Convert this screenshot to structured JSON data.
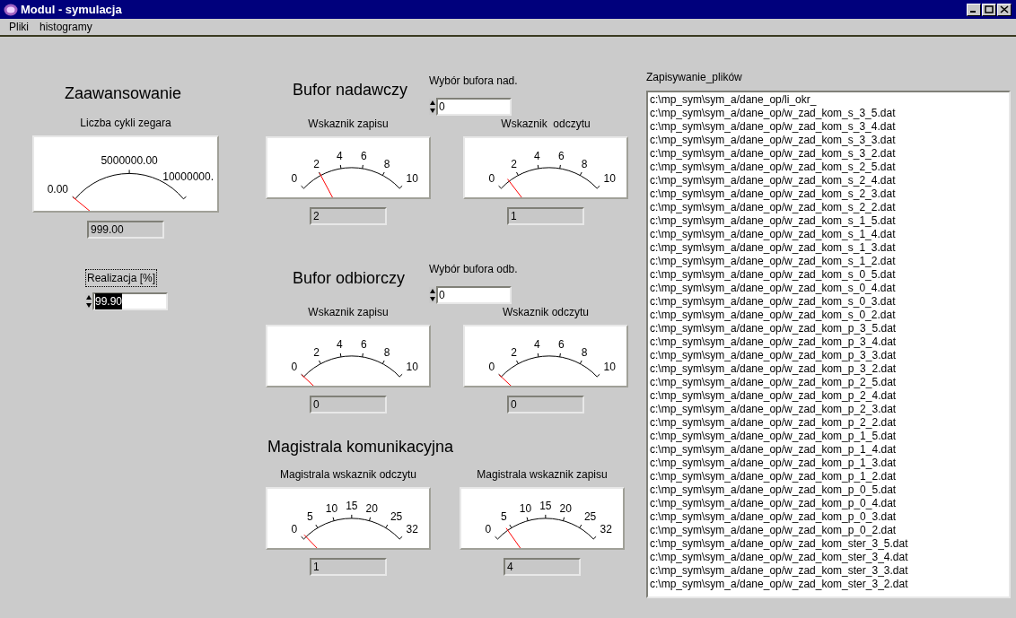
{
  "window": {
    "title": "Modul - symulacja"
  },
  "menu": [
    {
      "label": "Pliki"
    },
    {
      "label": "histogramy"
    }
  ],
  "zaawansowanie": {
    "title": "Zaawansowanie",
    "gauge": {
      "label": "Liczba cykli zegara",
      "scale": [
        "0.00",
        "5000000.00",
        "10000000."
      ],
      "reading": "999.00"
    },
    "realizacja": {
      "label": "Realizacja [%]",
      "value": "99.90",
      "selected": true
    }
  },
  "bufor_nadawczy": {
    "title": "Bufor nadawczy",
    "selector": {
      "label": "Wybór bufora nad.",
      "value": "0"
    },
    "gauges": [
      {
        "label": "Wskaznik zapisu",
        "scale": [
          "0",
          "2",
          "4",
          "6",
          "8",
          "10"
        ],
        "reading": "2"
      },
      {
        "label": "Wskaznik  odczytu",
        "scale": [
          "0",
          "2",
          "4",
          "6",
          "8",
          "10"
        ],
        "reading": "1"
      }
    ]
  },
  "bufor_odbiorczy": {
    "title": "Bufor odbiorczy",
    "selector": {
      "label": "Wybór bufora odb.",
      "value": "0"
    },
    "gauges": [
      {
        "label": "Wskaznik zapisu",
        "scale": [
          "0",
          "2",
          "4",
          "6",
          "8",
          "10"
        ],
        "reading": "0"
      },
      {
        "label": "Wskaznik odczytu",
        "scale": [
          "0",
          "2",
          "4",
          "6",
          "8",
          "10"
        ],
        "reading": "0"
      }
    ]
  },
  "magistrala": {
    "title": "Magistrala komunikacyjna",
    "gauges": [
      {
        "label": "Magistrala wskaznik odczytu",
        "scale": [
          "0",
          "5",
          "10",
          "15",
          "20",
          "25",
          "32"
        ],
        "reading": "1"
      },
      {
        "label": "Magistrala wskaznik zapisu",
        "scale": [
          "0",
          "5",
          "10",
          "15",
          "20",
          "25",
          "32"
        ],
        "reading": "4"
      }
    ]
  },
  "files": {
    "label": "Zapisywanie_plików",
    "items": [
      "c:\\mp_sym\\sym_a/dane_op/li_okr_",
      "c:\\mp_sym\\sym_a/dane_op/w_zad_kom_s_3_5.dat",
      "c:\\mp_sym\\sym_a/dane_op/w_zad_kom_s_3_4.dat",
      "c:\\mp_sym\\sym_a/dane_op/w_zad_kom_s_3_3.dat",
      "c:\\mp_sym\\sym_a/dane_op/w_zad_kom_s_3_2.dat",
      "c:\\mp_sym\\sym_a/dane_op/w_zad_kom_s_2_5.dat",
      "c:\\mp_sym\\sym_a/dane_op/w_zad_kom_s_2_4.dat",
      "c:\\mp_sym\\sym_a/dane_op/w_zad_kom_s_2_3.dat",
      "c:\\mp_sym\\sym_a/dane_op/w_zad_kom_s_2_2.dat",
      "c:\\mp_sym\\sym_a/dane_op/w_zad_kom_s_1_5.dat",
      "c:\\mp_sym\\sym_a/dane_op/w_zad_kom_s_1_4.dat",
      "c:\\mp_sym\\sym_a/dane_op/w_zad_kom_s_1_3.dat",
      "c:\\mp_sym\\sym_a/dane_op/w_zad_kom_s_1_2.dat",
      "c:\\mp_sym\\sym_a/dane_op/w_zad_kom_s_0_5.dat",
      "c:\\mp_sym\\sym_a/dane_op/w_zad_kom_s_0_4.dat",
      "c:\\mp_sym\\sym_a/dane_op/w_zad_kom_s_0_3.dat",
      "c:\\mp_sym\\sym_a/dane_op/w_zad_kom_s_0_2.dat",
      "c:\\mp_sym\\sym_a/dane_op/w_zad_kom_p_3_5.dat",
      "c:\\mp_sym\\sym_a/dane_op/w_zad_kom_p_3_4.dat",
      "c:\\mp_sym\\sym_a/dane_op/w_zad_kom_p_3_3.dat",
      "c:\\mp_sym\\sym_a/dane_op/w_zad_kom_p_3_2.dat",
      "c:\\mp_sym\\sym_a/dane_op/w_zad_kom_p_2_5.dat",
      "c:\\mp_sym\\sym_a/dane_op/w_zad_kom_p_2_4.dat",
      "c:\\mp_sym\\sym_a/dane_op/w_zad_kom_p_2_3.dat",
      "c:\\mp_sym\\sym_a/dane_op/w_zad_kom_p_2_2.dat",
      "c:\\mp_sym\\sym_a/dane_op/w_zad_kom_p_1_5.dat",
      "c:\\mp_sym\\sym_a/dane_op/w_zad_kom_p_1_4.dat",
      "c:\\mp_sym\\sym_a/dane_op/w_zad_kom_p_1_3.dat",
      "c:\\mp_sym\\sym_a/dane_op/w_zad_kom_p_1_2.dat",
      "c:\\mp_sym\\sym_a/dane_op/w_zad_kom_p_0_5.dat",
      "c:\\mp_sym\\sym_a/dane_op/w_zad_kom_p_0_4.dat",
      "c:\\mp_sym\\sym_a/dane_op/w_zad_kom_p_0_3.dat",
      "c:\\mp_sym\\sym_a/dane_op/w_zad_kom_p_0_2.dat",
      "c:\\mp_sym\\sym_a/dane_op/w_zad_kom_ster_3_5.dat",
      "c:\\mp_sym\\sym_a/dane_op/w_zad_kom_ster_3_4.dat",
      "c:\\mp_sym\\sym_a/dane_op/w_zad_kom_ster_3_3.dat",
      "c:\\mp_sym\\sym_a/dane_op/w_zad_kom_ster_3_2.dat"
    ]
  }
}
